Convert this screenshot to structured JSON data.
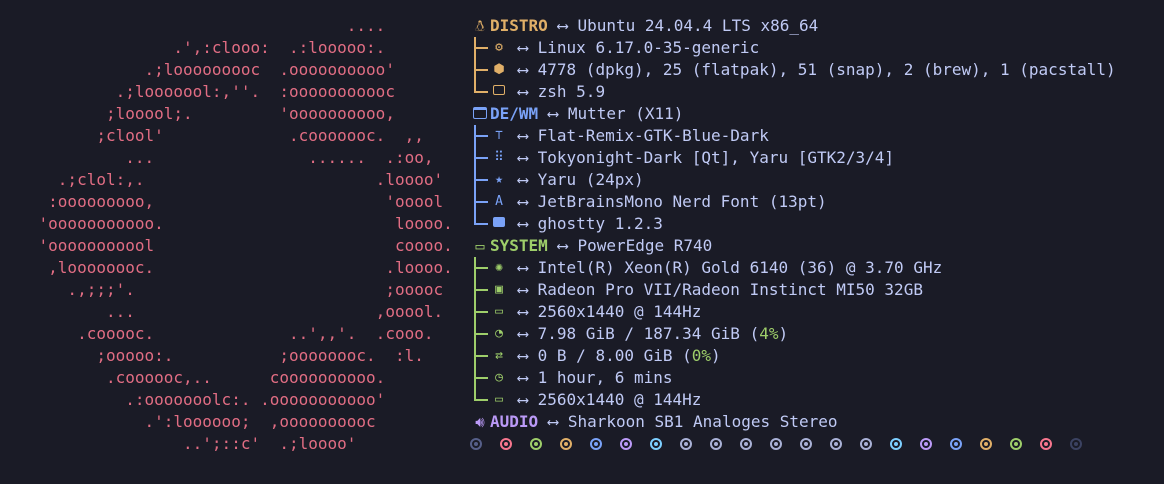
{
  "logo": {
    "lines": [
      "                                    ....",
      "                  .',:clooo:  .:looooo:.",
      "               .;looooooooc  .oooooooooo'",
      "            .;looooool:,''.  :ooooooooooc",
      "           ;looool;.         'oooooooooo,",
      "          ;clool'             .cooooooc.  ,,",
      "             ...                ......  .:oo,",
      "      .;clol:,.                        .loooo'",
      "     :ooooooooo,                        'ooool",
      "    'ooooooooooo.                        loooo.",
      "    'ooooooooool                         coooo.",
      "     ,loooooooc.                        .loooo.",
      "       .,;;;'.                          ;ooooc",
      "           ...                         ,ooool.",
      "        .cooooc.              ..',,'.  .cooo.",
      "          ;ooooo:.           ;oooooooc.  :l.",
      "           .coooooc,..      coooooooooo.",
      "             .:ooooooolc:. .ooooooooooo'",
      "               .':loooooo;  ,oooooooooc",
      "                   ..';::c'  .;loooo'"
    ]
  },
  "colors": {
    "logo": "#f7768e",
    "distro": "#e0af68",
    "de": "#7aa2f7",
    "system": "#9ece6a",
    "audio": "#bb9af7",
    "text": "#c0caf5",
    "background": "#1a1b26"
  },
  "arrow": "⟷",
  "distro": {
    "icon": "linux-icon",
    "key": "DISTRO",
    "value": "Ubuntu 24.04.4 LTS x86_64",
    "items": [
      {
        "icon": "gear-icon",
        "value": "Linux 6.17.0-35-generic"
      },
      {
        "icon": "package-icon",
        "value": "4778 (dpkg), 25 (flatpak), 51 (snap), 2 (brew), 1 (pacstall)"
      },
      {
        "icon": "terminal-icon",
        "value": "zsh 5.9"
      }
    ]
  },
  "de": {
    "icon": "window-icon",
    "key": "DE/WM",
    "value": "Mutter (X11)",
    "items": [
      {
        "icon": "paint-roller-icon",
        "value": "Flat-Remix-GTK-Blue-Dark"
      },
      {
        "icon": "grid-icon",
        "value": "Tokyonight-Dark [Qt], Yaru [GTK2/3/4]"
      },
      {
        "icon": "star-icon",
        "value": "Yaru (24px)"
      },
      {
        "icon": "font-icon",
        "value": "JetBrainsMono Nerd Font (13pt)"
      },
      {
        "icon": "terminal-box-icon",
        "value": "ghostty 1.2.3"
      }
    ]
  },
  "system": {
    "icon": "laptop-icon",
    "key": "SYSTEM",
    "value": "PowerEdge R740",
    "items": [
      {
        "icon": "cpu-icon",
        "value": "Intel(R) Xeon(R) Gold 6140 (36) @ 3.70 GHz"
      },
      {
        "icon": "gpu-icon",
        "value": "Radeon Pro VII/Radeon Instinct MI50 32GB"
      },
      {
        "icon": "monitor-icon",
        "value": "2560x1440 @ 144Hz"
      },
      {
        "icon": "memory-gauge-icon",
        "value": "7.98 GiB / 187.34 GiB (",
        "pct": "4%",
        "tail": ")"
      },
      {
        "icon": "swap-icon",
        "value": "0 B / 8.00 GiB (",
        "pct": "0%",
        "tail": ")"
      },
      {
        "icon": "clock-icon",
        "value": "1 hour, 6 mins"
      },
      {
        "icon": "monitor-icon",
        "value": "2560x1440 @ 144Hz"
      }
    ]
  },
  "audio": {
    "icon": "speaker-icon",
    "key": "AUDIO",
    "value": "Sharkoon SB1 Analoges Stereo"
  },
  "palette_dots": [
    "#565f89",
    "#f7768e",
    "#9ece6a",
    "#e0af68",
    "#7aa2f7",
    "#bb9af7",
    "#7dcfff",
    "#a9b1d6",
    "#a9b1d6",
    "#a9b1d6",
    "#a9b1d6",
    "#a9b1d6",
    "#a9b1d6",
    "#a9b1d6",
    "#7dcfff",
    "#bb9af7",
    "#7aa2f7",
    "#e0af68",
    "#9ece6a",
    "#f7768e",
    "#3b4261"
  ]
}
